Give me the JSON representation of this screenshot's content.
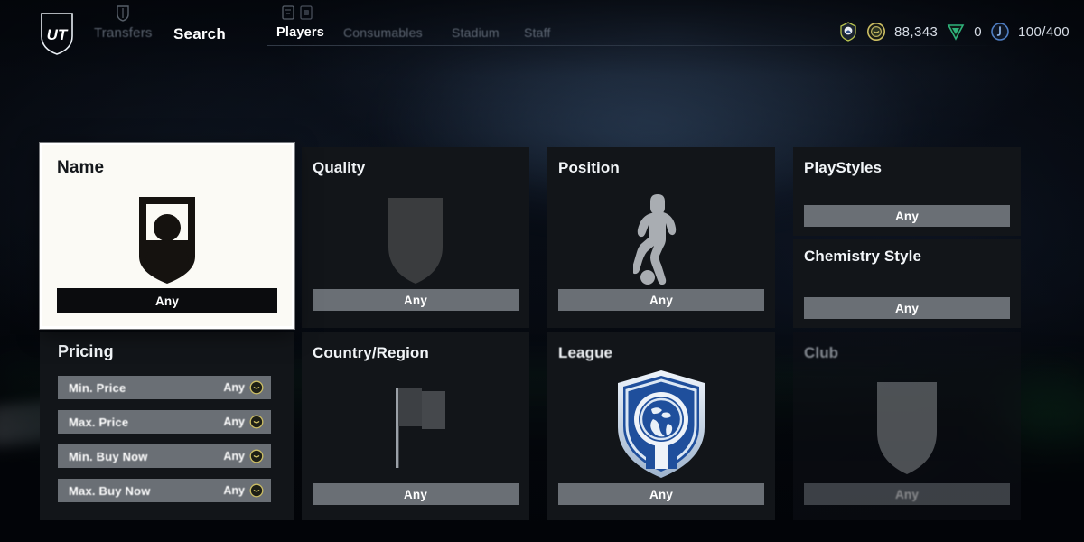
{
  "app": {
    "logo_text": "UT",
    "logo_name": "ut-crest-logo"
  },
  "topnav": {
    "primary": [
      {
        "label": "Transfers",
        "active": false,
        "icon": "crest-icon"
      },
      {
        "label": "Search",
        "active": true
      }
    ],
    "secondary": [
      {
        "label": "Players",
        "active": true,
        "icon": "card-icon"
      },
      {
        "label": "Consumables",
        "active": false,
        "icon": "card-icon"
      },
      {
        "label": "Stadium",
        "active": false
      },
      {
        "label": "Staff",
        "active": false
      }
    ]
  },
  "currency": {
    "items": [
      {
        "name": "club-badge-icon",
        "icon": "club-badge",
        "value": ""
      },
      {
        "name": "coins",
        "icon": "coin-icon",
        "value": "88,343"
      },
      {
        "name": "fc-points",
        "icon": "points-icon",
        "value": "0"
      },
      {
        "name": "transfer-list",
        "icon": "transfer-icon",
        "value": "100/400"
      }
    ]
  },
  "filters": {
    "name": {
      "title": "Name",
      "value": "Any",
      "icon": "player-portrait-icon",
      "selected": true
    },
    "quality": {
      "title": "Quality",
      "value": "Any",
      "icon": "shield-icon"
    },
    "position": {
      "title": "Position",
      "value": "Any",
      "icon": "player-silhouette-icon"
    },
    "playstyles": {
      "title": "PlayStyles",
      "value": "Any"
    },
    "chemistry_style": {
      "title": "Chemistry Style",
      "value": "Any"
    },
    "pricing": {
      "title": "Pricing",
      "rows": [
        {
          "label": "Min. Price",
          "value": "Any",
          "icon": "coin-icon"
        },
        {
          "label": "Max. Price",
          "value": "Any",
          "icon": "coin-icon"
        },
        {
          "label": "Min. Buy Now",
          "value": "Any",
          "icon": "coin-icon"
        },
        {
          "label": "Max. Buy Now",
          "value": "Any",
          "icon": "coin-icon"
        }
      ]
    },
    "country": {
      "title": "Country/Region",
      "value": "Any",
      "icon": "flag-icon"
    },
    "league": {
      "title": "League",
      "value": "Any",
      "icon": "league-globe-shield-icon"
    },
    "club": {
      "title": "Club",
      "value": "Any",
      "icon": "shield-icon",
      "dimmed": true
    }
  },
  "colors": {
    "card_bg": "#121519",
    "selected_card_bg": "#fbfaf5",
    "value_bar": "#6a6f75",
    "coin_gold": "#c9b862",
    "league_blue": "#1f4f9c",
    "text_primary": "#f2f5f8",
    "pitch_green": "#1e7a42"
  }
}
